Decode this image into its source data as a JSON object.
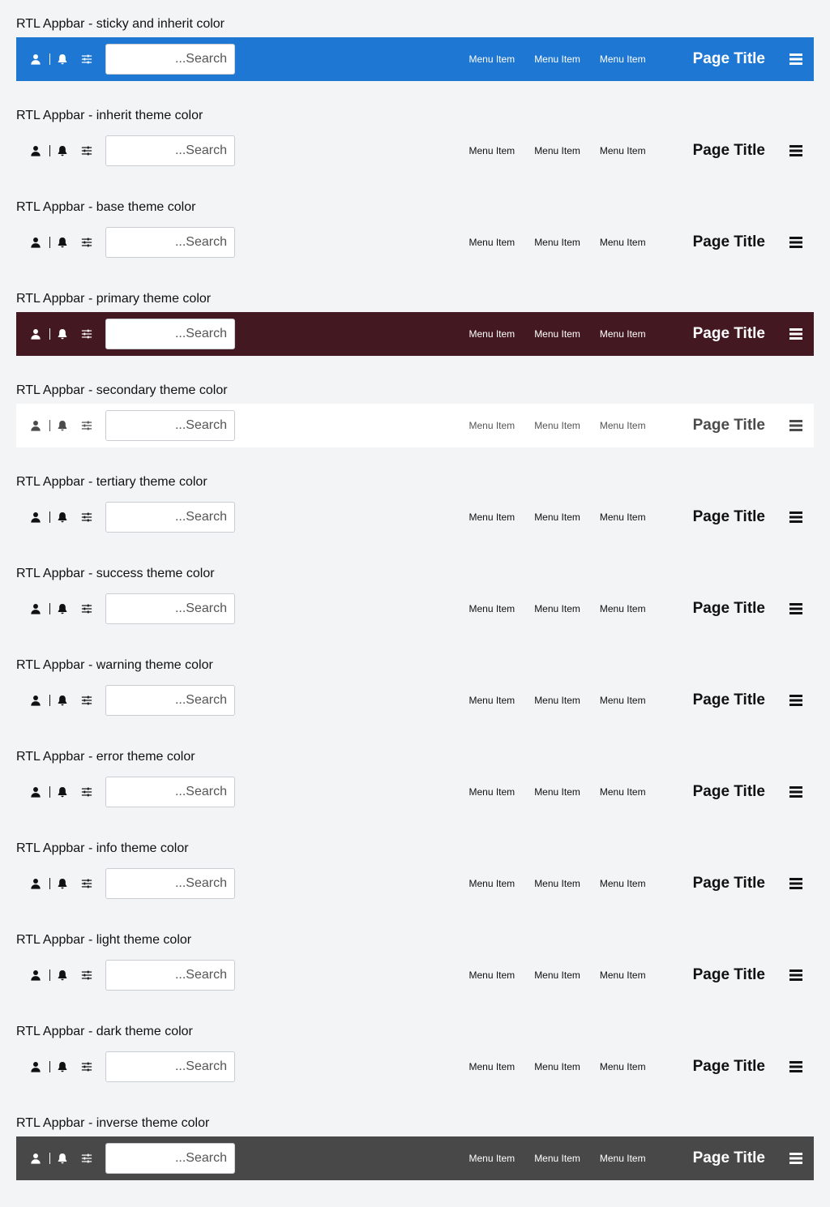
{
  "sections": [
    {
      "title": "RTL Appbar - sticky and inherit color",
      "theme": "sticky"
    },
    {
      "title": "RTL Appbar - inherit theme color",
      "theme": "plain"
    },
    {
      "title": "RTL Appbar - base theme color",
      "theme": "plain"
    },
    {
      "title": "RTL Appbar - primary theme color",
      "theme": "primary"
    },
    {
      "title": "RTL Appbar - secondary theme color",
      "theme": "secondary"
    },
    {
      "title": "RTL Appbar - tertiary theme color",
      "theme": "plain"
    },
    {
      "title": "RTL Appbar - success theme color",
      "theme": "plain"
    },
    {
      "title": "RTL Appbar - warning theme color",
      "theme": "plain"
    },
    {
      "title": "RTL Appbar - error theme color",
      "theme": "plain"
    },
    {
      "title": "RTL Appbar - info theme color",
      "theme": "plain"
    },
    {
      "title": "RTL Appbar - light theme color",
      "theme": "plain"
    },
    {
      "title": "RTL Appbar - dark theme color",
      "theme": "plain"
    },
    {
      "title": "RTL Appbar - inverse theme color",
      "theme": "inverse"
    }
  ],
  "appbar": {
    "page_title": "Page Title",
    "menu_items": [
      "Menu Item",
      "Menu Item",
      "Menu Item"
    ],
    "search_placeholder": "...Search",
    "icons": [
      "user-icon",
      "bell-icon",
      "sliders-icon",
      "menu-icon"
    ]
  },
  "colors": {
    "sticky": "#1e77d2",
    "primary": "#441820",
    "secondary": "#ffffff",
    "inverse": "#484848",
    "page_background": "#f3f4f6"
  }
}
